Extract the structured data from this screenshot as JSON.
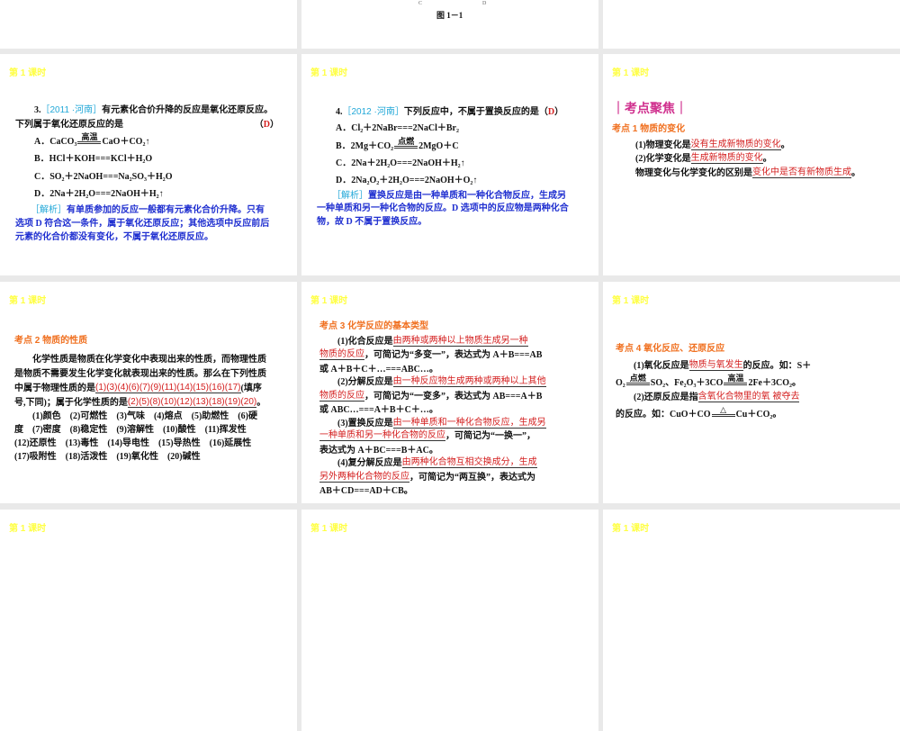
{
  "colors": {
    "label": "#ffff44",
    "tag": "#22a8d8",
    "answer": "#d42020",
    "analysis": "#1f2fd0",
    "heading": "#d0308e",
    "section": "#f07020"
  },
  "slide_label": "第 1 课时",
  "top_slide": {
    "figure_caption": "图 1－1",
    "fig_c": "C",
    "fig_d": "D"
  },
  "slides": [
    {
      "id": "q3",
      "lines": [
        [
          [
            "t",
            "3."
          ],
          [
            "c",
            "［2011 ·河南］"
          ],
          [
            "t",
            " 有元素化合价升降的反应是氧化还原反应。"
          ]
        ],
        [
          [
            "t",
            "下列属于氧化还原反应的是"
          ],
          [
            "gap",
            ""
          ],
          [
            "t",
            "（ "
          ],
          [
            "r",
            "D"
          ],
          [
            "t",
            " ）"
          ]
        ],
        [
          [
            "t",
            "A．CaCO₃"
          ],
          [
            "cond",
            "高温"
          ],
          [
            "t",
            "CaO＋CO₂↑"
          ]
        ],
        [
          [
            "t",
            "B．HCl＋KOH===KCl＋H₂O"
          ]
        ],
        [
          [
            "t",
            "C．SO₂＋2NaOH===Na₂SO₃＋H₂O"
          ]
        ],
        [
          [
            "t",
            "D．2Na＋2H₂O===2NaOH＋H₂↑"
          ]
        ],
        [
          [
            "c",
            "［解析］"
          ],
          [
            "b",
            " 有单质参加的反应一般都有元素化合价升降。只有"
          ]
        ],
        [
          [
            "b",
            "选项 D 符合这一条件，属于氧化还原反应；其他选项中反应前后"
          ]
        ],
        [
          [
            "b",
            "元素的化合价都没有变化，不属于氧化还原反应。"
          ]
        ]
      ]
    },
    {
      "id": "q4",
      "lines": [
        [
          [
            "t",
            "4."
          ],
          [
            "c",
            "［2012 ·河南］"
          ],
          [
            "t",
            " 下列反应中，不属于置换反应的是（ "
          ],
          [
            "r",
            "D"
          ],
          [
            "t",
            " ）"
          ]
        ],
        [
          [
            "t",
            "A．Cl₂＋2NaBr===2NaCl＋Br₂"
          ]
        ],
        [
          [
            "t",
            "B．2Mg＋CO₂"
          ],
          [
            "cond",
            "点燃"
          ],
          [
            "t",
            "2MgO＋C"
          ]
        ],
        [
          [
            "t",
            "C．2Na＋2H₂O===2NaOH＋H₂↑"
          ]
        ],
        [
          [
            "t",
            "D．2Na₂O₂＋2H₂O===2NaOH＋O₂↑"
          ]
        ],
        [
          [
            "c",
            "［解析］"
          ],
          [
            "b",
            " 置换反应是由一种单质和一种化合物反应，生成另"
          ]
        ],
        [
          [
            "b",
            "一种单质和另一种化合物的反应。D 选项中的反应物是两种化合"
          ]
        ],
        [
          [
            "b",
            "物，故 D 不属于置换反应。"
          ]
        ]
      ]
    },
    {
      "id": "kd1",
      "lines": [
        [
          [
            "h",
            "｜考点聚焦｜"
          ]
        ],
        [
          [
            "o",
            "考点 1  物质的变化"
          ]
        ],
        [
          [
            "t",
            "(1)物理变化是"
          ],
          [
            "f",
            "没有生成新物质的变化                         "
          ],
          [
            "t",
            "。"
          ]
        ],
        [
          [
            "t",
            "(2)化学变化是"
          ],
          [
            "f",
            "生成新物质的变化                                   "
          ],
          [
            "t",
            "。"
          ]
        ],
        [
          [
            "t",
            "物理变化与化学变化的区别是"
          ],
          [
            "f",
            "变化中是否有新物质生成"
          ],
          [
            "t",
            "。"
          ]
        ]
      ]
    },
    {
      "id": "kd2",
      "lines": [
        [
          [
            "o",
            "考点 2  物质的性质"
          ]
        ],
        [
          [
            "t",
            "　　化学性质是物质在化学变化中表现出来的性质，而物理性质"
          ]
        ],
        [
          [
            "t",
            "是物质不需要发生化学变化就表现出来的性质。那么在下列性质"
          ]
        ],
        [
          [
            "t",
            "中属于物理性质的是"
          ],
          [
            "f",
            "(1)(3)(4)(6)(7)(9)(11)(14)(15)(16)(17)"
          ],
          [
            "t",
            "(填序"
          ]
        ],
        [
          [
            "t",
            "号,下同)；属于化学性质的是"
          ],
          [
            "f",
            " (2)(5)(8)(10)(12)(13)(18)(19)(20) "
          ],
          [
            "t",
            "。"
          ]
        ],
        [
          [
            "t",
            "　　(1)颜色　(2)可燃性　(3)气味　(4)熔点　(5)助燃性　(6)硬"
          ]
        ],
        [
          [
            "t",
            "度　(7)密度　(8)稳定性　(9)溶解性　(10)酸性　(11)挥发性"
          ]
        ],
        [
          [
            "t",
            "(12)还原性　(13)毒性　(14)导电性　(15)导热性　(16)延展性"
          ]
        ],
        [
          [
            "t",
            "(17)吸附性　(18)活泼性　(19)氧化性　(20)碱性"
          ]
        ]
      ]
    },
    {
      "id": "kd3",
      "lines": [
        [
          [
            "o",
            "考点 3  化学反应的基本类型"
          ]
        ],
        [
          [
            "t",
            "　　(1)化合反应是"
          ],
          [
            "f",
            "  由两种或两种以上物质生成另一种    "
          ]
        ],
        [
          [
            "f",
            "  物质的反应 "
          ],
          [
            "t",
            "，可简记为“多变一”，表达式为 A＋B===AB"
          ]
        ],
        [
          [
            "t",
            "或 A＋B＋C＋…===ABC…。"
          ]
        ],
        [
          [
            "t",
            "　　(2)分解反应是"
          ],
          [
            "f",
            "由一种反应物生成两种或两种以上其他"
          ]
        ],
        [
          [
            "f",
            "物质的反应  "
          ],
          [
            "t",
            "，可简记为“一变多”，表达式为 AB===A＋B"
          ]
        ],
        [
          [
            "t",
            "或 ABC…===A＋B＋C＋…。"
          ]
        ],
        [
          [
            "t",
            "　　(3)置换反应是"
          ],
          [
            "f",
            "  由一种单质和一种化合物反应，生成另"
          ]
        ],
        [
          [
            "f",
            "  一种单质和另一种化合物的反应      "
          ],
          [
            "t",
            "，可简记为“一换一”，"
          ]
        ],
        [
          [
            "t",
            "表达式为 A＋BC===B＋AC。"
          ]
        ],
        [
          [
            "t",
            "　　(4)复分解反应是"
          ],
          [
            "f",
            "由两种化合物互相交换成分，生成    "
          ]
        ],
        [
          [
            "f",
            "  另外两种化合物的反应     "
          ],
          [
            "t",
            "，可简记为“两互换”，表达式为"
          ]
        ],
        [
          [
            "t",
            "AB＋CD===AD＋CB。"
          ]
        ]
      ]
    },
    {
      "id": "kd4",
      "lines": [
        [
          [
            "o",
            "考点 4  氧化反应、还原反应"
          ]
        ],
        [
          [
            "t",
            "　　(1)氧化反应是"
          ],
          [
            "f",
            "          物质与氧发生          "
          ],
          [
            "t",
            "的反应。如：S＋"
          ]
        ],
        [
          [
            "t",
            "O₂"
          ],
          [
            "cond",
            "点燃"
          ],
          [
            "t",
            "SO₂、Fe₂O₃＋3CO"
          ],
          [
            "cond",
            "高温"
          ],
          [
            "t",
            "2Fe＋3CO₂。"
          ]
        ],
        [
          [
            "t",
            "　　(2)还原反应是指"
          ],
          [
            "f",
            "    含氧化合物里的氧 被夺去                  "
          ]
        ],
        [
          [
            "t",
            "的反应。如：CuO＋CO"
          ],
          [
            "cond",
            "△"
          ],
          [
            "t",
            "Cu＋CO₂。"
          ]
        ]
      ]
    }
  ]
}
